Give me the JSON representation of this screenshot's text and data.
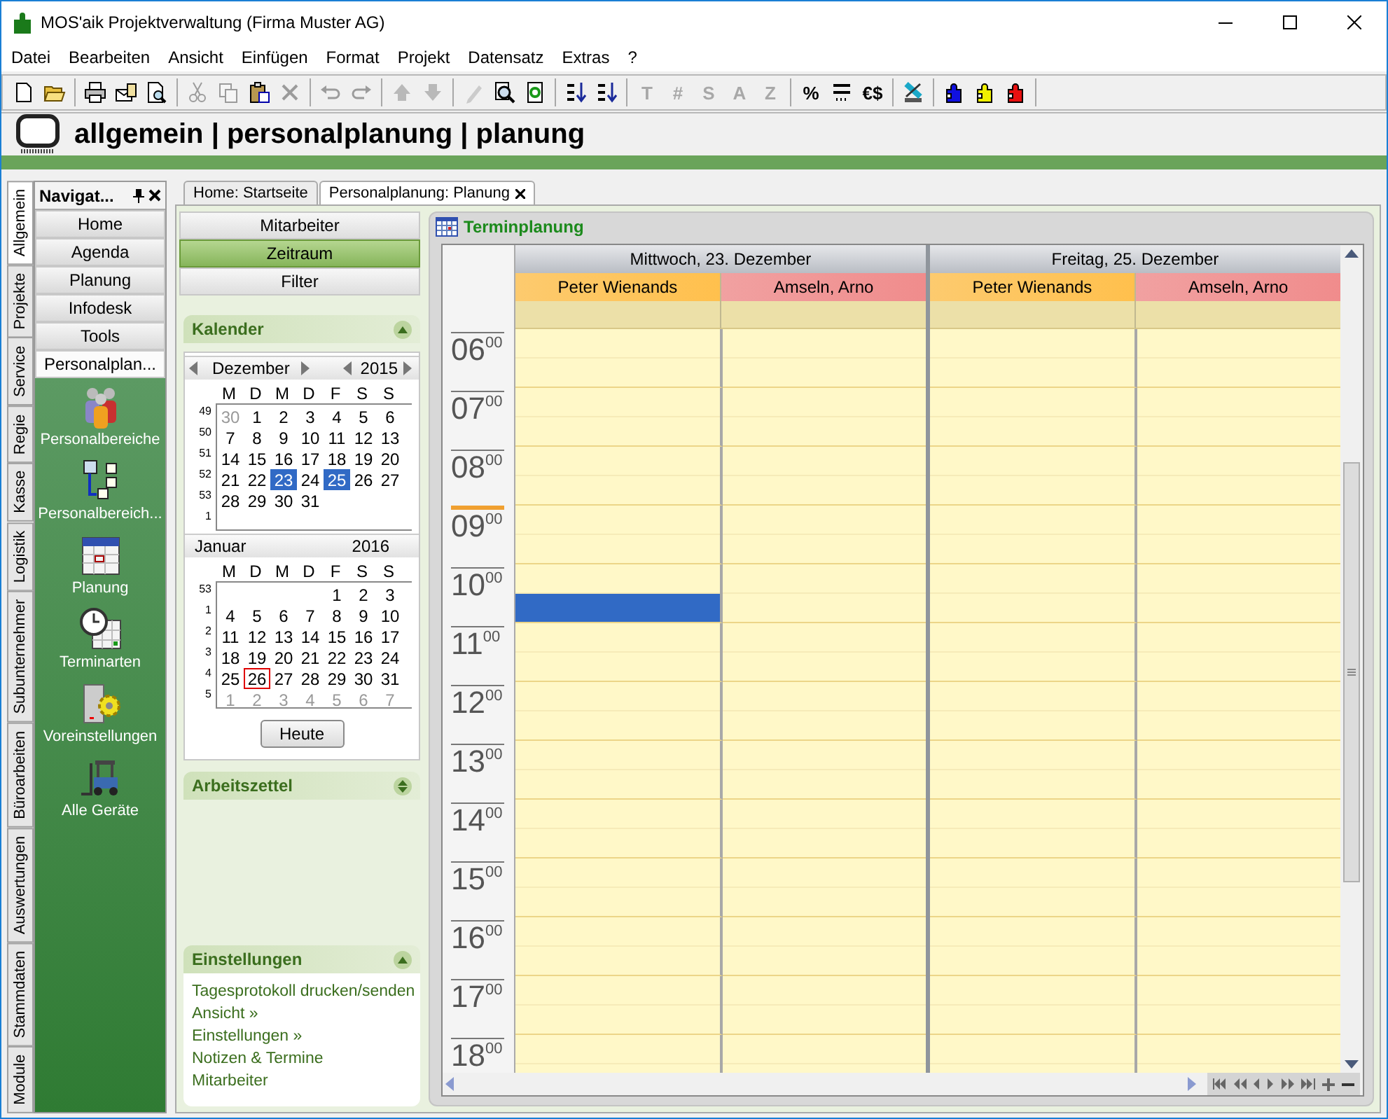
{
  "window": {
    "title": "MOS'aik Projektverwaltung (Firma Muster AG)"
  },
  "menu": [
    "Datei",
    "Bearbeiten",
    "Ansicht",
    "Einfügen",
    "Format",
    "Projekt",
    "Datensatz",
    "Extras",
    "?"
  ],
  "toolbar": [
    [
      {
        "kind": "icon",
        "disabled": false
      },
      {
        "kind": "icon",
        "disabled": false
      }
    ],
    [
      {
        "kind": "icon",
        "disabled": false
      },
      {
        "kind": "icon",
        "disabled": false
      },
      {
        "kind": "icon",
        "disabled": false
      }
    ],
    [
      {
        "kind": "icon",
        "disabled": true
      },
      {
        "kind": "icon",
        "disabled": true
      },
      {
        "kind": "icon",
        "disabled": false
      },
      {
        "kind": "icon",
        "disabled": true
      }
    ],
    [
      {
        "kind": "icon",
        "disabled": true
      },
      {
        "kind": "icon",
        "disabled": true
      }
    ],
    [
      {
        "kind": "icon",
        "disabled": true
      },
      {
        "kind": "icon",
        "disabled": true
      }
    ],
    [
      {
        "kind": "icon",
        "disabled": true
      },
      {
        "kind": "icon",
        "disabled": false
      },
      {
        "kind": "icon",
        "disabled": false
      }
    ],
    [
      {
        "kind": "icon",
        "disabled": false
      },
      {
        "kind": "icon",
        "disabled": false
      }
    ],
    [
      {
        "kind": "glyph",
        "glyph": "T",
        "disabled": true
      },
      {
        "kind": "glyph",
        "glyph": "#",
        "disabled": true
      },
      {
        "kind": "glyph",
        "glyph": "S",
        "disabled": true
      },
      {
        "kind": "glyph",
        "glyph": "A",
        "disabled": true
      },
      {
        "kind": "glyph",
        "glyph": "Z",
        "disabled": true
      }
    ],
    [
      {
        "kind": "glyph",
        "glyph": "%",
        "disabled": false
      },
      {
        "kind": "icon",
        "disabled": false
      },
      {
        "kind": "glyph",
        "glyph": "€$",
        "disabled": false
      }
    ],
    [
      {
        "kind": "icon",
        "disabled": false
      }
    ],
    [
      {
        "kind": "icon",
        "disabled": false
      },
      {
        "kind": "icon",
        "disabled": false
      },
      {
        "kind": "icon",
        "disabled": false
      }
    ]
  ],
  "breadcrumb": "allgemein | personalplanung | planung",
  "side_tabs": [
    {
      "label": "Allgemein",
      "selected": true
    },
    {
      "label": "Projekte",
      "selected": false
    },
    {
      "label": "Service",
      "selected": false
    },
    {
      "label": "Regie",
      "selected": false
    },
    {
      "label": "Kasse",
      "selected": false
    },
    {
      "label": "Logistik",
      "selected": false
    },
    {
      "label": "Subunternehmer",
      "selected": false
    },
    {
      "label": "Büroarbeiten",
      "selected": false
    },
    {
      "label": "Auswertungen",
      "selected": false
    },
    {
      "label": "Stammdaten",
      "selected": false
    },
    {
      "label": "Module",
      "selected": false
    }
  ],
  "navigator": {
    "title": "Navigat...",
    "buttons": [
      {
        "label": "Home",
        "selected": false
      },
      {
        "label": "Agenda",
        "selected": false
      },
      {
        "label": "Planung",
        "selected": false
      },
      {
        "label": "Infodesk",
        "selected": false
      },
      {
        "label": "Tools",
        "selected": false
      },
      {
        "label": "Personalplan...",
        "selected": true
      }
    ],
    "items": [
      "Personalbereiche",
      "Personalbereich...",
      "Planung",
      "Terminarten",
      "Voreinstellungen",
      "Alle Geräte"
    ]
  },
  "doc_tabs": [
    {
      "label": "Home: Startseite",
      "selected": false
    },
    {
      "label": "Personalplanung: Planung",
      "selected": true
    }
  ],
  "view_buttons": [
    {
      "label": "Mitarbeiter",
      "selected": false
    },
    {
      "label": "Zeitraum",
      "selected": true
    },
    {
      "label": "Filter",
      "selected": false
    }
  ],
  "calendar_panel": {
    "title": "Kalender",
    "expanded": true,
    "today_button": "Heute",
    "months": [
      {
        "month": "Dezember",
        "year": "2015",
        "arrows": true,
        "weekdays": [
          "M",
          "D",
          "M",
          "D",
          "F",
          "S",
          "S"
        ],
        "weeks": [
          {
            "week": "49",
            "days": [
              {
                "day": "30",
                "selected": false,
                "muted": true,
                "today": false
              },
              {
                "day": "1",
                "selected": false,
                "muted": false,
                "today": false
              },
              {
                "day": "2",
                "selected": false,
                "muted": false,
                "today": false
              },
              {
                "day": "3",
                "selected": false,
                "muted": false,
                "today": false
              },
              {
                "day": "4",
                "selected": false,
                "muted": false,
                "today": false
              },
              {
                "day": "5",
                "selected": false,
                "muted": false,
                "today": false
              },
              {
                "day": "6",
                "selected": false,
                "muted": false,
                "today": false
              }
            ]
          },
          {
            "week": "50",
            "days": [
              {
                "day": "7",
                "selected": false,
                "muted": false,
                "today": false
              },
              {
                "day": "8",
                "selected": false,
                "muted": false,
                "today": false
              },
              {
                "day": "9",
                "selected": false,
                "muted": false,
                "today": false
              },
              {
                "day": "10",
                "selected": false,
                "muted": false,
                "today": false
              },
              {
                "day": "11",
                "selected": false,
                "muted": false,
                "today": false
              },
              {
                "day": "12",
                "selected": false,
                "muted": false,
                "today": false
              },
              {
                "day": "13",
                "selected": false,
                "muted": false,
                "today": false
              }
            ]
          },
          {
            "week": "51",
            "days": [
              {
                "day": "14",
                "selected": false,
                "muted": false,
                "today": false
              },
              {
                "day": "15",
                "selected": false,
                "muted": false,
                "today": false
              },
              {
                "day": "16",
                "selected": false,
                "muted": false,
                "today": false
              },
              {
                "day": "17",
                "selected": false,
                "muted": false,
                "today": false
              },
              {
                "day": "18",
                "selected": false,
                "muted": false,
                "today": false
              },
              {
                "day": "19",
                "selected": false,
                "muted": false,
                "today": false
              },
              {
                "day": "20",
                "selected": false,
                "muted": false,
                "today": false
              }
            ]
          },
          {
            "week": "52",
            "days": [
              {
                "day": "21",
                "selected": false,
                "muted": false,
                "today": false
              },
              {
                "day": "22",
                "selected": false,
                "muted": false,
                "today": false
              },
              {
                "day": "23",
                "selected": true,
                "muted": false,
                "today": false
              },
              {
                "day": "24",
                "selected": false,
                "muted": false,
                "today": false
              },
              {
                "day": "25",
                "selected": true,
                "muted": false,
                "today": false
              },
              {
                "day": "26",
                "selected": false,
                "muted": false,
                "today": false
              },
              {
                "day": "27",
                "selected": false,
                "muted": false,
                "today": false
              }
            ]
          },
          {
            "week": "53",
            "days": [
              {
                "day": "28",
                "selected": false,
                "muted": false,
                "today": false
              },
              {
                "day": "29",
                "selected": false,
                "muted": false,
                "today": false
              },
              {
                "day": "30",
                "selected": false,
                "muted": false,
                "today": false
              },
              {
                "day": "31",
                "selected": false,
                "muted": false,
                "today": false
              }
            ]
          },
          {
            "week": "1"
          }
        ]
      },
      {
        "month": "Januar",
        "year": "2016",
        "arrows": false,
        "weekdays": [
          "M",
          "D",
          "M",
          "D",
          "F",
          "S",
          "S"
        ],
        "weeks": [
          {
            "week": "53",
            "starts_midweek": true,
            "days": [
              {
                "day": "1",
                "selected": false,
                "muted": false,
                "today": false
              },
              {
                "day": "2",
                "selected": false,
                "muted": false,
                "today": false
              },
              {
                "day": "3",
                "selected": false,
                "muted": false,
                "today": false
              }
            ]
          },
          {
            "week": "1",
            "days": [
              {
                "day": "4",
                "selected": false,
                "muted": false,
                "today": false
              },
              {
                "day": "5",
                "selected": false,
                "muted": false,
                "today": false
              },
              {
                "day": "6",
                "selected": false,
                "muted": false,
                "today": false
              },
              {
                "day": "7",
                "selected": false,
                "muted": false,
                "today": false
              },
              {
                "day": "8",
                "selected": false,
                "muted": false,
                "today": false
              },
              {
                "day": "9",
                "selected": false,
                "muted": false,
                "today": false
              },
              {
                "day": "10",
                "selected": false,
                "muted": false,
                "today": false
              }
            ]
          },
          {
            "week": "2",
            "days": [
              {
                "day": "11",
                "selected": false,
                "muted": false,
                "today": false
              },
              {
                "day": "12",
                "selected": false,
                "muted": false,
                "today": false
              },
              {
                "day": "13",
                "selected": false,
                "muted": false,
                "today": false
              },
              {
                "day": "14",
                "selected": false,
                "muted": false,
                "today": false
              },
              {
                "day": "15",
                "selected": false,
                "muted": false,
                "today": false
              },
              {
                "day": "16",
                "selected": false,
                "muted": false,
                "today": false
              },
              {
                "day": "17",
                "selected": false,
                "muted": false,
                "today": false
              }
            ]
          },
          {
            "week": "3",
            "days": [
              {
                "day": "18",
                "selected": false,
                "muted": false,
                "today": false
              },
              {
                "day": "19",
                "selected": false,
                "muted": false,
                "today": false
              },
              {
                "day": "20",
                "selected": false,
                "muted": false,
                "today": false
              },
              {
                "day": "21",
                "selected": false,
                "muted": false,
                "today": false
              },
              {
                "day": "22",
                "selected": false,
                "muted": false,
                "today": false
              },
              {
                "day": "23",
                "selected": false,
                "muted": false,
                "today": false
              },
              {
                "day": "24",
                "selected": false,
                "muted": false,
                "today": false
              }
            ]
          },
          {
            "week": "4",
            "days": [
              {
                "day": "25",
                "selected": false,
                "muted": false,
                "today": false
              },
              {
                "day": "26",
                "selected": false,
                "muted": false,
                "today": true
              },
              {
                "day": "27",
                "selected": false,
                "muted": false,
                "today": false
              },
              {
                "day": "28",
                "selected": false,
                "muted": false,
                "today": false
              },
              {
                "day": "29",
                "selected": false,
                "muted": false,
                "today": false
              },
              {
                "day": "30",
                "selected": false,
                "muted": false,
                "today": false
              },
              {
                "day": "31",
                "selected": false,
                "muted": false,
                "today": false
              }
            ]
          },
          {
            "week": "5",
            "days": [
              {
                "day": "1",
                "selected": false,
                "muted": true,
                "today": false
              },
              {
                "day": "2",
                "selected": false,
                "muted": true,
                "today": false
              },
              {
                "day": "3",
                "selected": false,
                "muted": true,
                "today": false
              },
              {
                "day": "4",
                "selected": false,
                "muted": true,
                "today": false
              },
              {
                "day": "5",
                "selected": false,
                "muted": true,
                "today": false
              },
              {
                "day": "6",
                "selected": false,
                "muted": true,
                "today": false
              },
              {
                "day": "7",
                "selected": false,
                "muted": true,
                "today": false
              }
            ]
          }
        ]
      }
    ]
  },
  "worksheet_panel": {
    "title": "Arbeitszettel",
    "expanded": false
  },
  "settings_panel": {
    "title": "Einstellungen",
    "expanded": true,
    "links": [
      "Tagesprotokoll drucken/senden",
      "Ansicht »",
      "Einstellungen »",
      "Notizen & Termine",
      "Mitarbeiter"
    ]
  },
  "scheduler": {
    "title": "Terminplanung",
    "days": [
      {
        "label": "Mittwoch, 23. Dezember",
        "resources": [
          {
            "name": "Peter Wienands",
            "color": "#ffc04d"
          },
          {
            "name": "Amseln, Arno",
            "color": "#f08c8c"
          }
        ]
      },
      {
        "label": "Freitag, 25. Dezember",
        "resources": [
          {
            "name": "Peter Wienands",
            "color": "#ffc04d"
          },
          {
            "name": "Amseln, Arno",
            "color": "#f08c8c"
          }
        ]
      }
    ],
    "hours": [
      {
        "label": "06$^{00}$",
        "now": false,
        "booked": [
          [
            false,
            false,
            false,
            false
          ],
          [
            false,
            false,
            false,
            false
          ]
        ]
      },
      {
        "label": "07$^{00}$",
        "now": false,
        "booked": [
          [
            false,
            false,
            false,
            false
          ],
          [
            false,
            false,
            false,
            false
          ]
        ]
      },
      {
        "label": "08$^{00}$",
        "now": false,
        "booked": [
          [
            false,
            false,
            false,
            false
          ],
          [
            false,
            false,
            false,
            false
          ]
        ]
      },
      {
        "label": "09$^{00}$",
        "now": true,
        "booked": [
          [
            false,
            false,
            false,
            false
          ],
          [
            false,
            false,
            false,
            false
          ]
        ]
      },
      {
        "label": "10$^{00}$",
        "now": false,
        "booked": [
          [
            false,
            false,
            false,
            false
          ],
          [
            true,
            false,
            false,
            false
          ]
        ]
      },
      {
        "label": "11$^{00}$",
        "now": false,
        "booked": [
          [
            false,
            false,
            false,
            false
          ],
          [
            false,
            false,
            false,
            false
          ]
        ]
      },
      {
        "label": "12$^{00}$",
        "now": false,
        "booked": [
          [
            false,
            false,
            false,
            false
          ],
          [
            false,
            false,
            false,
            false
          ]
        ]
      },
      {
        "label": "13$^{00}$",
        "now": false,
        "booked": [
          [
            false,
            false,
            false,
            false
          ],
          [
            false,
            false,
            false,
            false
          ]
        ]
      },
      {
        "label": "14$^{00}$",
        "now": false,
        "booked": [
          [
            false,
            false,
            false,
            false
          ],
          [
            false,
            false,
            false,
            false
          ]
        ]
      },
      {
        "label": "15$^{00}$",
        "now": false,
        "booked": [
          [
            false,
            false,
            false,
            false
          ],
          [
            false,
            false,
            false,
            false
          ]
        ]
      },
      {
        "label": "16$^{00}$",
        "now": false,
        "booked": [
          [
            false,
            false,
            false,
            false
          ],
          [
            false,
            false,
            false,
            false
          ]
        ]
      },
      {
        "label": "17$^{00}$",
        "now": false,
        "booked": [
          [
            false,
            false,
            false,
            false
          ],
          [
            false,
            false,
            false,
            false
          ]
        ]
      },
      {
        "label": "18$^{00}$",
        "now": false,
        "booked": [
          [
            false,
            false,
            false,
            false
          ],
          [
            false,
            false,
            false,
            false
          ]
        ]
      }
    ]
  }
}
